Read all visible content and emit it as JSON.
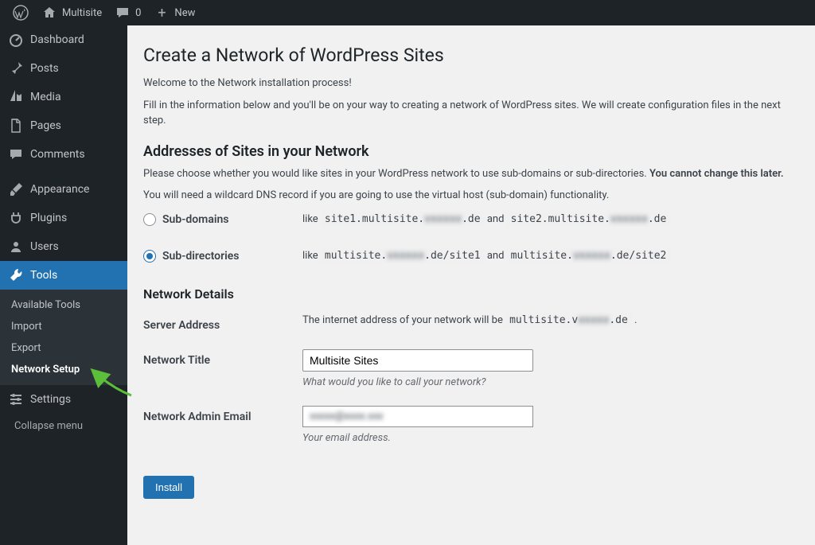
{
  "adminbar": {
    "site_name": "Multisite",
    "comments_count": "0",
    "new_label": "New"
  },
  "sidebar": {
    "items": [
      {
        "icon": "dashboard",
        "label": "Dashboard"
      },
      {
        "icon": "pin",
        "label": "Posts"
      },
      {
        "icon": "media",
        "label": "Media"
      },
      {
        "icon": "page",
        "label": "Pages"
      },
      {
        "icon": "comment",
        "label": "Comments"
      },
      {
        "icon": "brush",
        "label": "Appearance"
      },
      {
        "icon": "plug",
        "label": "Plugins"
      },
      {
        "icon": "users",
        "label": "Users"
      },
      {
        "icon": "wrench",
        "label": "Tools"
      },
      {
        "icon": "sliders",
        "label": "Settings"
      }
    ],
    "tools_submenu": [
      "Available Tools",
      "Import",
      "Export",
      "Network Setup"
    ],
    "collapse_label": "Collapse menu"
  },
  "page": {
    "title": "Create a Network of WordPress Sites",
    "intro1": "Welcome to the Network installation process!",
    "intro2": "Fill in the information below and you'll be on your way to creating a network of WordPress sites. We will create configuration files in the next step.",
    "addresses_heading": "Addresses of Sites in your Network",
    "addresses_p1a": "Please choose whether you would like sites in your WordPress network to use sub-domains or sub-directories. ",
    "addresses_p1b": "You cannot change this later.",
    "addresses_p2": "You will need a wildcard DNS record if you are going to use the virtual host (sub-domain) functionality.",
    "option1": {
      "label": "Sub-domains",
      "like": "like ",
      "code1a": "site1.multisite.",
      "code1b_blur": "vxxxxx",
      "code1c": ".de",
      "and": " and ",
      "code2a": "site2.multisite.",
      "code2b_blur": "vxxxxx",
      "code2c": ".de"
    },
    "option2": {
      "label": "Sub-directories",
      "like": "like ",
      "code1a": "multisite.",
      "code1b_blur": "vxxxxx",
      "code1c": ".de/site1",
      "and": " and ",
      "code2a": "multisite.",
      "code2b_blur": "vxxxxx",
      "code2c": ".de/site2"
    },
    "details_heading": "Network Details",
    "server_address": {
      "label": "Server Address",
      "text": "The internet address of your network will be ",
      "code_a": "multisite.v",
      "code_b_blur": "xxxxx",
      "code_c": ".de",
      "period": " ."
    },
    "network_title": {
      "label": "Network Title",
      "value": "Multisite Sites",
      "desc": "What would you like to call your network?"
    },
    "admin_email": {
      "label": "Network Admin Email",
      "value_blur": "xxxxx@xxxx.xxx",
      "desc": "Your email address."
    },
    "install_button": "Install"
  }
}
